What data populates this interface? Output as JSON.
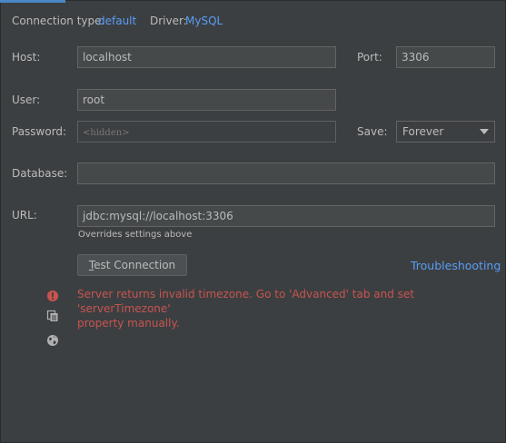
{
  "header": {
    "connection_type_label": "Connection type:",
    "connection_type_value": "default",
    "driver_label": "Driver:",
    "driver_value": "MySQL"
  },
  "form": {
    "host_label": "Host:",
    "host_value": "localhost",
    "port_label": "Port:",
    "port_value": "3306",
    "user_label": "User:",
    "user_value": "root",
    "password_label": "Password:",
    "password_placeholder": "<hidden>",
    "save_label": "Save:",
    "save_value": "Forever",
    "database_label": "Database:",
    "database_value": "",
    "url_label": "URL:",
    "url_value": "jdbc:mysql://localhost:3306",
    "url_hint": "Overrides settings above"
  },
  "actions": {
    "test_connection_mnemonic": "T",
    "test_connection_rest": "est Connection",
    "troubleshooting_label": "Troubleshooting"
  },
  "status": {
    "error_line1": "Server returns invalid timezone. Go to 'Advanced' tab and set 'serverTimezone'",
    "error_line2": "property manually."
  },
  "colors": {
    "background": "#3c3f41",
    "link": "#589df6",
    "error": "#c75450",
    "accent": "#4a88c7"
  },
  "icons": {
    "error": "error-icon",
    "copy": "copy-icon",
    "globe": "globe-icon"
  }
}
